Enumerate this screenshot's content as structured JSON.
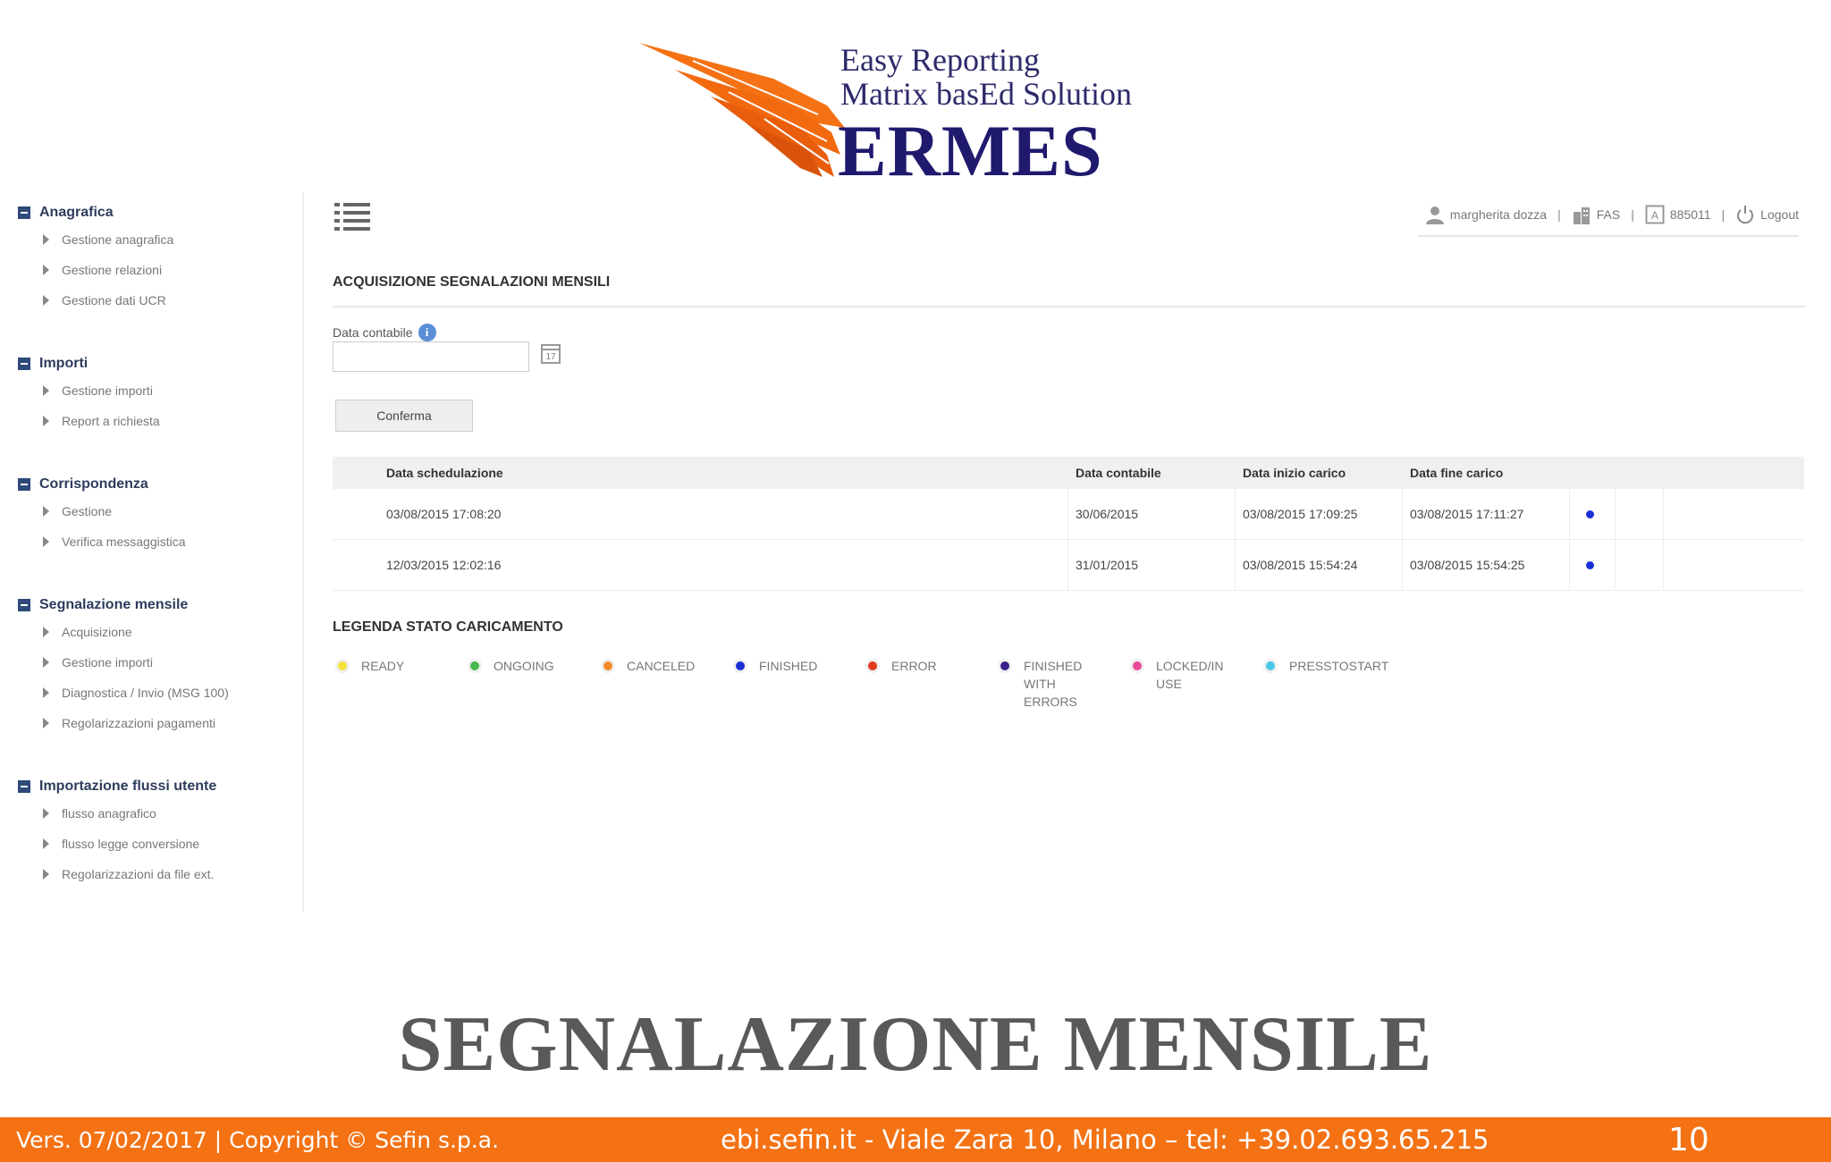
{
  "logo": {
    "tagline_1": "Easy Reporting",
    "tagline_2": "Matrix basEd Solution",
    "brand": "ERMES"
  },
  "sidebar": {
    "sections": [
      {
        "title": "Anagrafica",
        "items": [
          "Gestione anagrafica",
          "Gestione relazioni",
          "Gestione dati UCR"
        ]
      },
      {
        "title": "Importi",
        "items": [
          "Gestione importi",
          "Report a richiesta"
        ]
      },
      {
        "title": "Corrispondenza",
        "items": [
          "Gestione",
          "Verifica messaggistica"
        ]
      },
      {
        "title": "Segnalazione mensile",
        "items": [
          "Acquisizione",
          "Gestione importi",
          "Diagnostica / Invio (MSG 100)",
          "Regolarizzazioni pagamenti"
        ]
      },
      {
        "title": "Importazione flussi utente",
        "items": [
          "flusso anagrafico",
          "flusso legge conversione",
          "Regolarizzazioni da file ext."
        ]
      }
    ]
  },
  "userbar": {
    "user": "margherita dozza",
    "org": "FAS",
    "code": "885011",
    "logout": "Logout"
  },
  "main": {
    "title": "ACQUISIZIONE SEGNALAZIONI MENSILI",
    "date_label": "Data contabile",
    "date_value": "",
    "calendar_glyph": "17",
    "confirm_label": "Conferma"
  },
  "table": {
    "columns": [
      "Data schedulazione",
      "Data contabile",
      "Data inizio carico",
      "Data fine carico"
    ],
    "rows": [
      {
        "schedulazione": "03/08/2015 17:08:20",
        "contabile": "30/06/2015",
        "inizio": "03/08/2015 17:09:25",
        "fine": "03/08/2015 17:11:27",
        "status": "FINISHED"
      },
      {
        "schedulazione": "12/03/2015 12:02:16",
        "contabile": "31/01/2015",
        "inizio": "03/08/2015 15:54:24",
        "fine": "03/08/2015 15:54:25",
        "status": "FINISHED"
      }
    ]
  },
  "legend": {
    "title": "LEGENDA STATO CARICAMENTO",
    "items": [
      {
        "label": "READY",
        "color": "#f5e03a"
      },
      {
        "label": "ONGOING",
        "color": "#47b84a"
      },
      {
        "label": "CANCELED",
        "color": "#f08a2a"
      },
      {
        "label": "FINISHED",
        "color": "#1a2fd6"
      },
      {
        "label": "ERROR",
        "color": "#e23a1f"
      },
      {
        "label": "FINISHED WITH ERRORS",
        "color": "#3a1f8a"
      },
      {
        "label": "LOCKED/IN USE",
        "color": "#e84a9a"
      },
      {
        "label": "PRESSTOSTART",
        "color": "#4ac8e8"
      }
    ]
  },
  "slide": {
    "title": "SEGNALAZIONE MENSILE",
    "footer_left": "Vers. 07/02/2017 | Copyright © Sefin s.p.a.",
    "footer_center": "ebi.sefin.it  - Viale Zara 10, Milano – tel: +39.02.693.65.215",
    "page_number": "10"
  },
  "colors": {
    "footer_bg": "#f47214",
    "brand_blue": "#1f1a6e",
    "logo_orange": "#f47214"
  }
}
